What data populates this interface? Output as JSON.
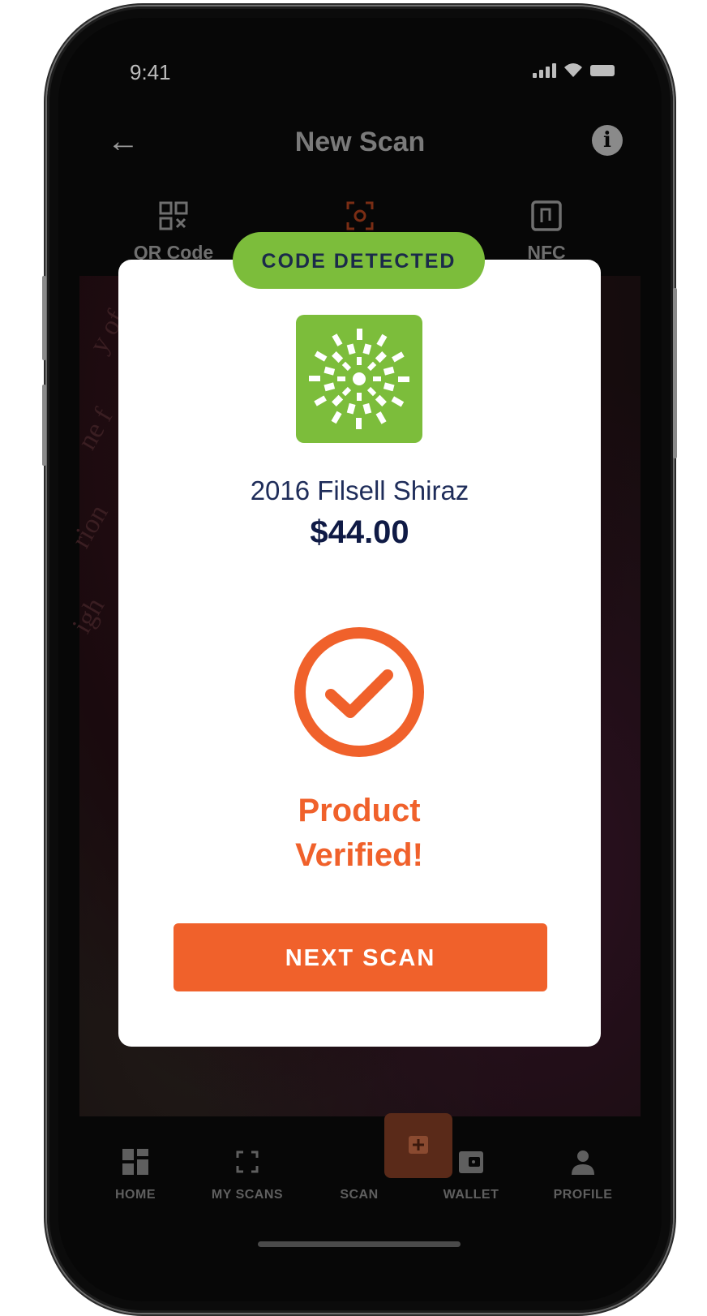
{
  "status_bar": {
    "time": "9:41"
  },
  "header": {
    "title": "New Scan",
    "back_icon": "arrow-left-icon",
    "info_icon": "info-icon"
  },
  "mode_tabs": [
    {
      "label": "QR Code",
      "icon": "qr-code-icon"
    },
    {
      "label": "",
      "icon": "camera-scan-icon",
      "active": true
    },
    {
      "label": "NFC",
      "icon": "nfc-icon"
    }
  ],
  "modal": {
    "badge": "CODE DETECTED",
    "product_name": "2016 Filsell Shiraz",
    "price": "$44.00",
    "status": "Product Verified!",
    "button": "NEXT SCAN"
  },
  "bottom_nav": [
    {
      "label": "HOME",
      "icon": "dashboard-icon"
    },
    {
      "label": "MY SCANS",
      "icon": "scan-frame-icon"
    },
    {
      "label": "SCAN",
      "icon": "plus-icon"
    },
    {
      "label": "WALLET",
      "icon": "wallet-icon"
    },
    {
      "label": "PROFILE",
      "icon": "user-icon"
    }
  ],
  "colors": {
    "accent": "#f0612b",
    "badge_green": "#7cbd3b",
    "text_navy": "#1f2d5a"
  }
}
